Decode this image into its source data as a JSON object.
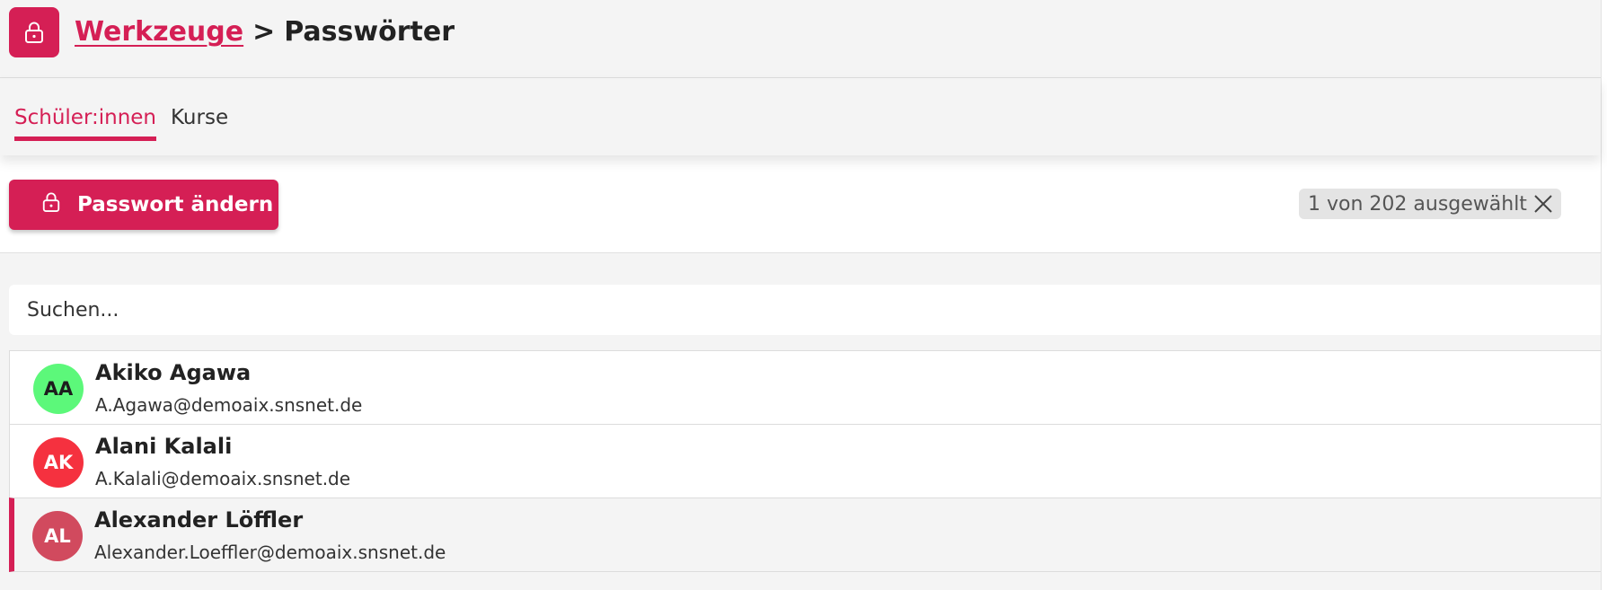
{
  "header": {
    "breadcrumb_parent": "Werkzeuge",
    "separator": ">",
    "breadcrumb_current": "Passwörter",
    "icon": "lock-icon"
  },
  "tabs": [
    {
      "label": "Schüler:innen",
      "active": true
    },
    {
      "label": "Kurse",
      "active": false
    }
  ],
  "toolbar": {
    "change_password_label": "Passwort ändern",
    "selection_text": "1 von 202 ausgewählt"
  },
  "search": {
    "placeholder": "Suchen..."
  },
  "users": [
    {
      "initials": "AA",
      "name": "Akiko Agawa",
      "email": "A.Agawa@demoaix.snsnet.de",
      "avatar_color": "#5cf87a",
      "avatar_text_color": "#1d1d1d",
      "selected": false
    },
    {
      "initials": "AK",
      "name": "Alani Kalali",
      "email": "A.Kalali@demoaix.snsnet.de",
      "avatar_color": "#f5313f",
      "avatar_text_color": "#ffffff",
      "selected": false
    },
    {
      "initials": "AL",
      "name": "Alexander Löffler",
      "email": "Alexander.Loeffler@demoaix.snsnet.de",
      "avatar_color": "#d14a5e",
      "avatar_text_color": "#ffffff",
      "selected": true
    }
  ],
  "colors": {
    "accent": "#d51f55",
    "background": "#f4f4f4",
    "chip_background": "#e4e4e4"
  }
}
